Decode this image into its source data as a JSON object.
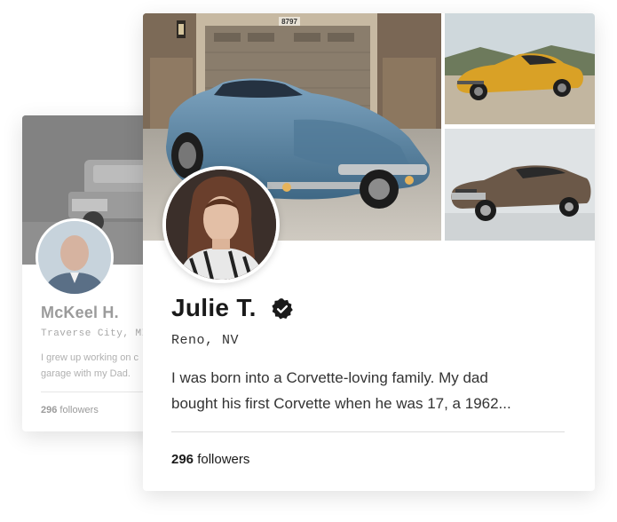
{
  "back_profile": {
    "name": "McKeel H.",
    "location": "Traverse City, MI",
    "bio": "I grew up working on c\ngarage with my Dad.",
    "followers_count": "296",
    "followers_label": "followers"
  },
  "main_profile": {
    "name": "Julie T.",
    "location": "Reno, NV",
    "bio": "I was born into a Corvette-loving family. My dad\nbought his first Corvette when he was 17, a 1962...",
    "followers_count": "296",
    "followers_label": "followers",
    "house_number": "8797"
  },
  "icons": {
    "verified": "verified-badge-icon"
  },
  "colors": {
    "verified": "#1a1a1a",
    "hero_car": "#5e89a8",
    "yellow_car": "#d9a126",
    "brown_car": "#6b5848"
  }
}
